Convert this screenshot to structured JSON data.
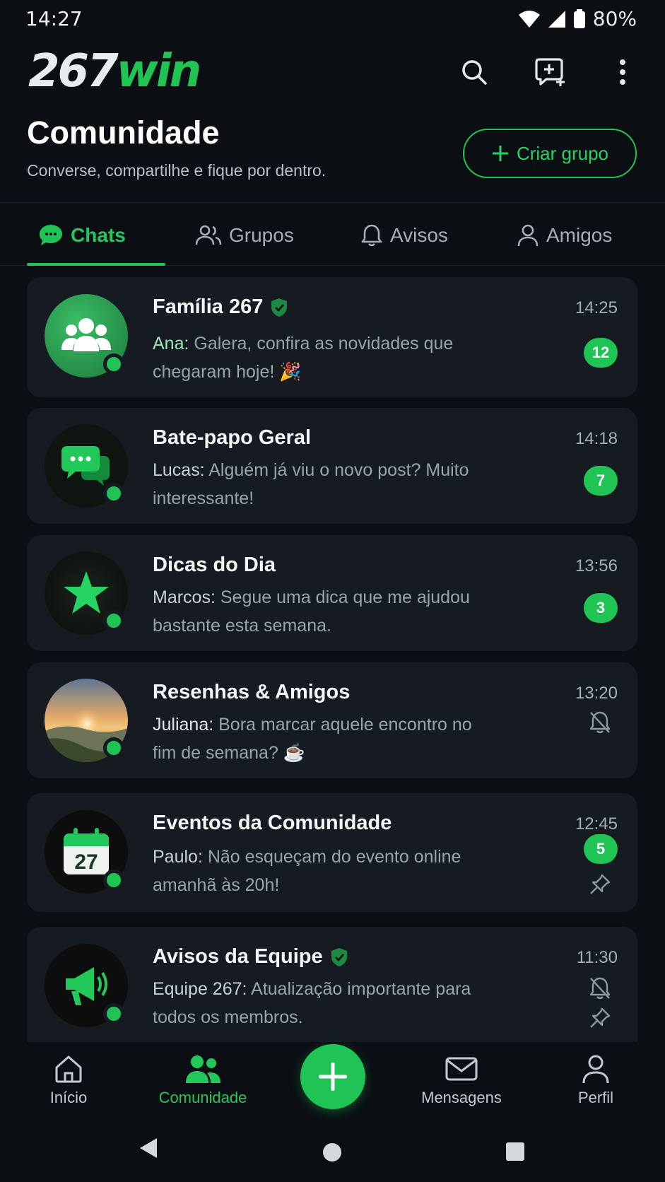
{
  "status": {
    "time": "14:27",
    "battery": "80%"
  },
  "brand": {
    "part1": "267",
    "part2": "win"
  },
  "header": {
    "title": "Comunidade",
    "subtitle": "Converse, compartilhe e fique por dentro.",
    "create_label": "Criar grupo"
  },
  "tabs": [
    {
      "label": "Chats",
      "icon": "chat-bubble-icon",
      "active": true
    },
    {
      "label": "Grupos",
      "icon": "users-icon"
    },
    {
      "label": "Avisos",
      "icon": "bell-icon"
    },
    {
      "label": "Amigos",
      "icon": "person-icon"
    }
  ],
  "chats": [
    {
      "name": "Família 267",
      "verified": true,
      "time": "14:25",
      "sender": "Ana:",
      "message": "Galera, confira as novidades que chegaram hoje! 🎉",
      "unread": "12"
    },
    {
      "name": "Bate-papo Geral",
      "time": "14:18",
      "sender": "Lucas:",
      "message": "Alguém já viu o novo post? Muito interessante!",
      "unread": "7"
    },
    {
      "name": "Dicas do Dia",
      "time": "13:56",
      "sender": "Marcos:",
      "message": "Segue uma dica que me ajudou bastante esta semana.",
      "unread": "3"
    },
    {
      "name": "Resenhas & Amigos",
      "time": "13:20",
      "sender": "Juliana:",
      "message": "Bora marcar aquele encontro no fim de semana? ☕",
      "muted": true
    },
    {
      "name": "Eventos da Comunidade",
      "time": "12:45",
      "sender": "Paulo:",
      "message": "Não esqueçam do evento online amanhã às 20h!",
      "unread": "5",
      "pinned": true,
      "calendar_day": "27"
    },
    {
      "name": "Avisos da Equipe",
      "verified": true,
      "time": "11:30",
      "sender": "Equipe 267:",
      "message": "Atualização importante para todos os membros.",
      "muted": true,
      "pinned": true
    }
  ],
  "bottom_nav": [
    {
      "label": "Início",
      "icon": "home-icon"
    },
    {
      "label": "Comunidade",
      "icon": "community-icon",
      "active": true
    },
    {
      "label": "Mensagens",
      "icon": "mail-icon"
    },
    {
      "label": "Perfil",
      "icon": "profile-icon"
    }
  ],
  "colors": {
    "accent": "#1fc455",
    "background": "#0b0f14",
    "card": "#161b22"
  }
}
